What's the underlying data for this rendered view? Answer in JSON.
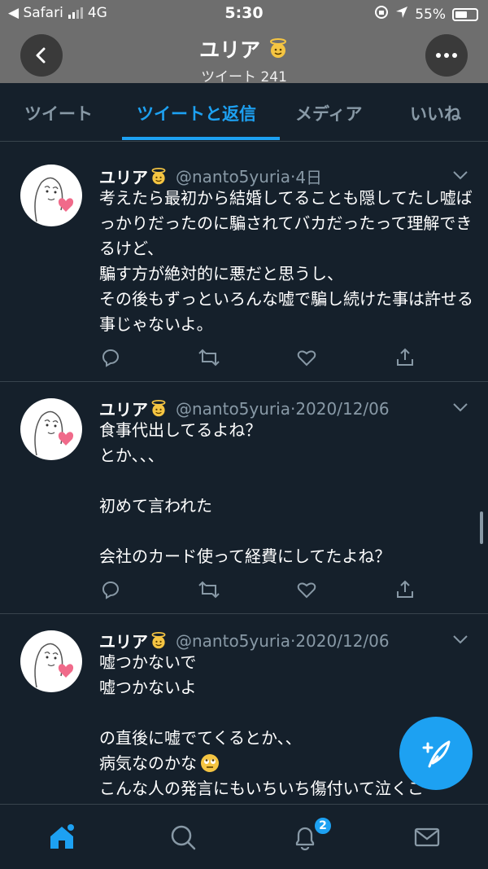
{
  "status_bar": {
    "back_app": "◀ Safari",
    "network": "4G",
    "time": "5:30",
    "battery": "55%"
  },
  "header": {
    "title": "ユリア",
    "subtitle": "ツイート 241",
    "back_icon": "chevron-left-icon",
    "more_icon": "more-dots-icon"
  },
  "tabs": [
    {
      "label": "ツイート",
      "active": false
    },
    {
      "label": "ツイートと返信",
      "active": true
    },
    {
      "label": "メディア",
      "active": false
    },
    {
      "label": "いいね",
      "active": false
    }
  ],
  "tweets": [
    {
      "name": "ユリア",
      "handle": "@nanto5yuria",
      "date": "4日",
      "text": "考えたら最初から結婚してることも隠してたし嘘ばっかりだったのに騙されてバカだったって理解できるけど、\n騙す方が絶対的に悪だと思うし、\nその後もずっといろんな嘘で騙し続けた事は許せる事じゃないよ。"
    },
    {
      "name": "ユリア",
      "handle": "@nanto5yuria",
      "date": "2020/12/06",
      "text": "食事代出してるよね？\nとか、、、\n\n初めて言われた\n\n会社のカード使って経費にしてたよね？"
    },
    {
      "name": "ユリア",
      "handle": "@nanto5yuria",
      "date": "2020/12/06",
      "text_lines": [
        "嘘つかないで",
        "嘘つかないよ",
        "",
        "の直後に嘘でてくるとか、、",
        "病気なのかな",
        "こんな人の発言にもいちいち傷付いて泣くこ"
      ]
    }
  ],
  "bottom_nav": {
    "notification_count": "2",
    "items": [
      "home-icon",
      "search-icon",
      "bell-icon",
      "mail-icon"
    ]
  },
  "colors": {
    "background": "#15202b",
    "accent": "#1da1f2",
    "secondary_text": "#8899a6",
    "divider": "#38444d"
  }
}
